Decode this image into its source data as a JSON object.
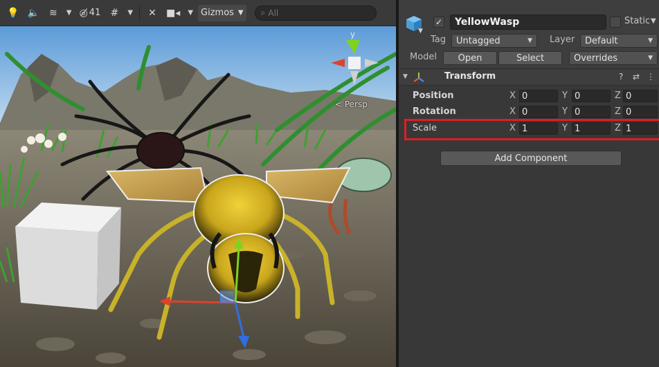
{
  "scene": {
    "toolbar": {
      "hidden_count": "41",
      "gizmos_label": "Gizmos",
      "search_placeholder": "All"
    },
    "persp_label": "< Persp",
    "gizmo_axis_label": "y"
  },
  "inspector": {
    "object": {
      "active": true,
      "name": "YellowWasp",
      "static_label": "Static"
    },
    "tag_label": "Tag",
    "tag_value": "Untagged",
    "layer_label": "Layer",
    "layer_value": "Default",
    "model_label": "Model",
    "open_button": "Open",
    "select_button": "Select",
    "overrides_label": "Overrides",
    "transform": {
      "title": "Transform",
      "rows": [
        {
          "label": "Position",
          "x": "0",
          "y": "0",
          "z": "0"
        },
        {
          "label": "Rotation",
          "x": "0",
          "y": "0",
          "z": "0"
        },
        {
          "label": "Scale",
          "x": "1",
          "y": "1",
          "z": "1"
        }
      ],
      "axis_x": "X",
      "axis_y": "Y",
      "axis_z": "Z"
    },
    "add_component_button": "Add Component"
  },
  "colors": {
    "highlight": "#e11d24",
    "inspector_bg": "#383838",
    "toolbar_bg": "#3a3a3a"
  }
}
